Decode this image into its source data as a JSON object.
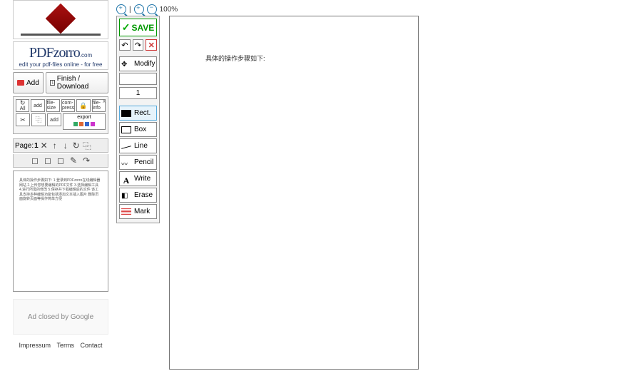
{
  "logo": {
    "name": "PDFzorro",
    "sub": ".com",
    "tagline": "edit your pdf-files online - for free"
  },
  "actions": {
    "add": "Add",
    "finish": "Finish / Download"
  },
  "mini": {
    "rotate": "↻",
    "all": "All",
    "add": "add",
    "file_size": "file-size",
    "compress": "com-press",
    "lock": "🔒",
    "file_info": "file-info",
    "cut": "✂",
    "copy": "⿻",
    "export": "export"
  },
  "page_nav": {
    "label": "Page:",
    "current": "1",
    "del": "✕",
    "up": "↑",
    "down": "↓",
    "rot": "↻",
    "copy": "⿻"
  },
  "thumb_text": "具体的操作步骤如下:\n\n1.登录到PDFzorro在线编辑器网站\n2.上传您想要编辑的PDF文件\n3.选择编辑工具\n4.进行所需的修改\n5.保存并下载编辑后的文件\n\n该工具支持多种编辑功能包括添加文本插入图片\n删除页面旋转页面等操作简单方便",
  "ad": "Ad closed by Google",
  "footer": {
    "impressum": "Impressum",
    "terms": "Terms",
    "contact": "Contact"
  },
  "zoom": {
    "sep": "|",
    "level": "100%"
  },
  "toolbox": {
    "save": "SAVE",
    "undo": "↶",
    "redo": "↷",
    "close": "✕",
    "modify": "Modify",
    "lw_value": "1",
    "rect": "Rect.",
    "box": "Box",
    "line": "Line",
    "pencil": "Pencil",
    "write": "Write",
    "erase": "Erase",
    "mark": "Mark"
  },
  "canvas": {
    "text": "具体的操作步骤如下:"
  }
}
